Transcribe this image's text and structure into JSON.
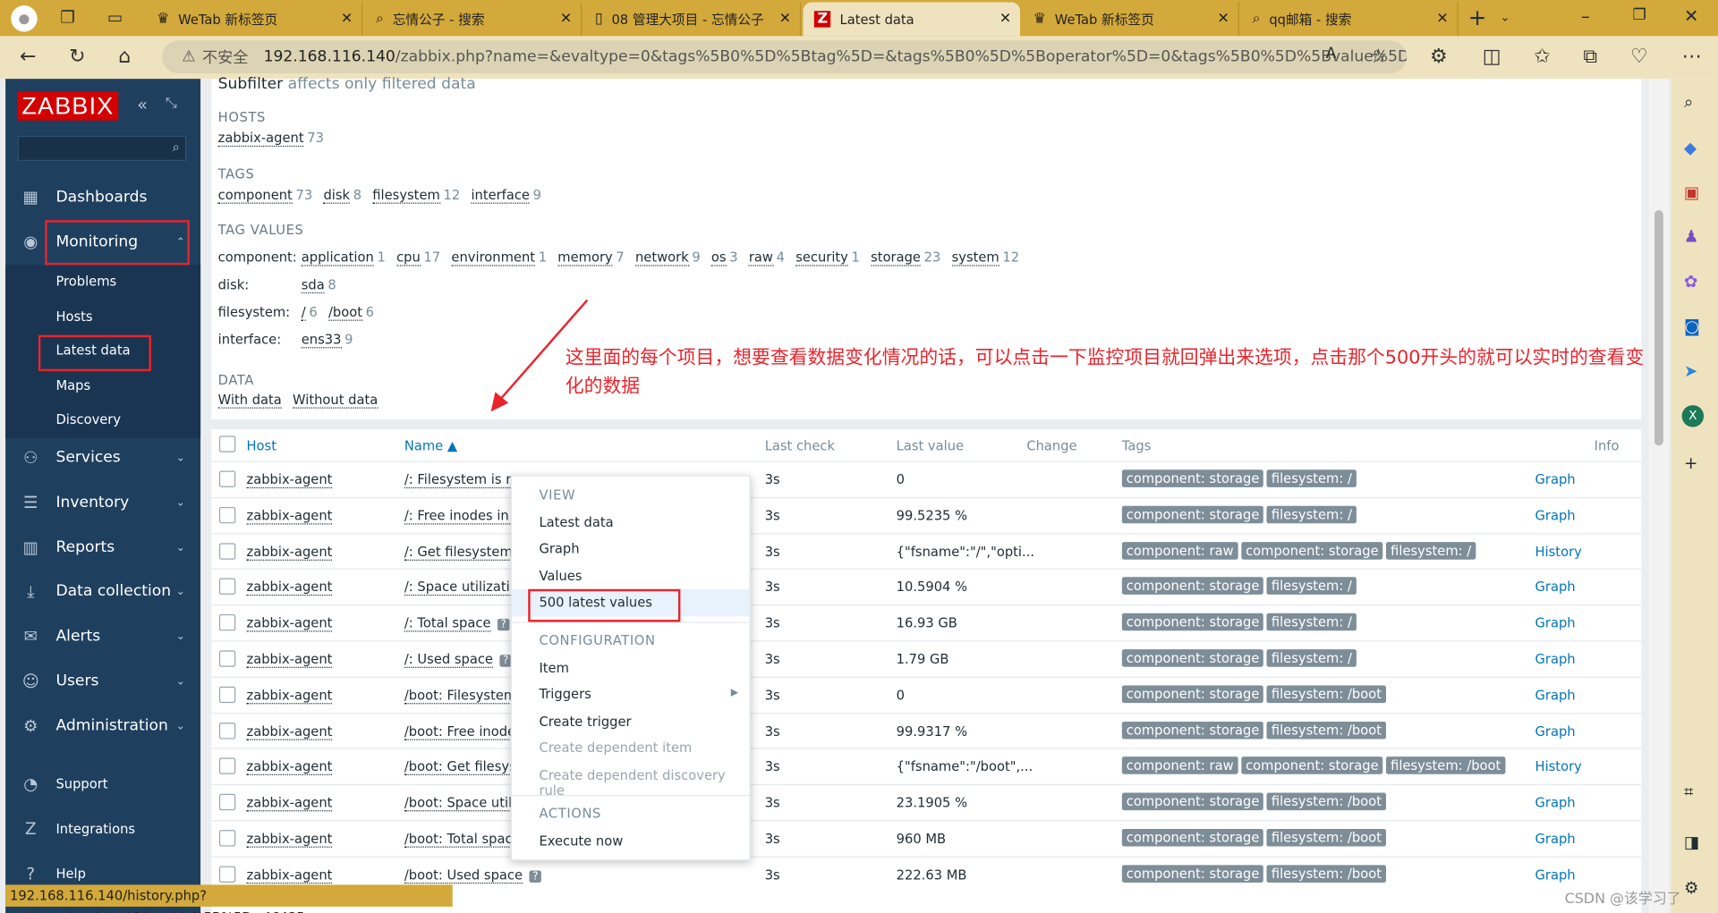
{
  "browser": {
    "tabs": [
      {
        "label": "WeTab 新标签页",
        "icon": "wetab-icon"
      },
      {
        "label": "忘情公子 - 搜索",
        "icon": "search-icon"
      },
      {
        "label": "08 管理大项目 - 忘情公子",
        "icon": "document-icon"
      },
      {
        "label": "Latest data",
        "icon": "zabbix-icon",
        "active": true
      },
      {
        "label": "WeTab 新标签页",
        "icon": "wetab-icon"
      },
      {
        "label": "qq邮箱 - 搜索",
        "icon": "search-icon"
      }
    ],
    "insecure_label": "不安全",
    "url_host": "192.168.116.140",
    "url_path": "/zabbix.php?name=&evaltype=0&tags%5B0%5D%5Btag%5D=&tags%5B0%5D%5Boperator%5D=0&tags%5B0%5D%5Bvalue%5D...",
    "status_url": "192.168.116.140/history.php?action=showlatest&itemids%5B%5D=46435",
    "watermark": "CSDN @该学习了"
  },
  "sidebar": {
    "logo": "ZABBIX",
    "items": [
      {
        "label": "Dashboards",
        "icon": "dashboard-icon"
      },
      {
        "label": "Monitoring",
        "icon": "eye-icon"
      },
      {
        "label": "Services",
        "icon": "services-icon"
      },
      {
        "label": "Inventory",
        "icon": "list-icon"
      },
      {
        "label": "Reports",
        "icon": "report-icon"
      },
      {
        "label": "Data collection",
        "icon": "download-icon"
      },
      {
        "label": "Alerts",
        "icon": "envelope-icon"
      },
      {
        "label": "Users",
        "icon": "users-icon"
      },
      {
        "label": "Administration",
        "icon": "gear-icon"
      }
    ],
    "monitoring_sub": [
      "Problems",
      "Hosts",
      "Latest data",
      "Maps",
      "Discovery"
    ],
    "bottom": [
      {
        "label": "Support"
      },
      {
        "label": "Integrations"
      },
      {
        "label": "Help"
      }
    ]
  },
  "subfilter": {
    "title": "Subfilter",
    "note": "affects only filtered data",
    "hosts_label": "HOSTS",
    "hosts": [
      {
        "name": "zabbix-agent",
        "count": "73"
      }
    ],
    "tags_label": "TAGS",
    "tags": [
      {
        "name": "component",
        "count": "73"
      },
      {
        "name": "disk",
        "count": "8"
      },
      {
        "name": "filesystem",
        "count": "12"
      },
      {
        "name": "interface",
        "count": "9"
      }
    ],
    "tag_values_label": "TAG VALUES",
    "tag_values": [
      {
        "key": "component:",
        "values": [
          {
            "name": "application",
            "count": "1"
          },
          {
            "name": "cpu",
            "count": "17"
          },
          {
            "name": "environment",
            "count": "1"
          },
          {
            "name": "memory",
            "count": "7"
          },
          {
            "name": "network",
            "count": "9"
          },
          {
            "name": "os",
            "count": "3"
          },
          {
            "name": "raw",
            "count": "4"
          },
          {
            "name": "security",
            "count": "1"
          },
          {
            "name": "storage",
            "count": "23"
          },
          {
            "name": "system",
            "count": "12"
          }
        ]
      },
      {
        "key": "disk:",
        "values": [
          {
            "name": "sda",
            "count": "8"
          }
        ]
      },
      {
        "key": "filesystem:",
        "values": [
          {
            "name": "/",
            "count": "6"
          },
          {
            "name": "/boot",
            "count": "6"
          }
        ]
      },
      {
        "key": "interface:",
        "values": [
          {
            "name": "ens33",
            "count": "9"
          }
        ]
      }
    ],
    "data_label": "DATA",
    "data": [
      "With data",
      "Without data"
    ]
  },
  "annotation": "这里面的每个项目，想要查看数据变化情况的话，可以点击一下监控项目就回弹出来选项，点击那个500开头的就可以实时的查看变化的数据",
  "table": {
    "headers": {
      "host": "Host",
      "name": "Name ▲",
      "last_check": "Last check",
      "last_value": "Last value",
      "change": "Change",
      "tags": "Tags",
      "info": "Info"
    },
    "rows": [
      {
        "host": "zabbix-agent",
        "name": "/: Filesystem is re",
        "check": "3s",
        "value": "0",
        "tags": [
          "component: storage",
          "filesystem: /"
        ],
        "info": "Graph"
      },
      {
        "host": "zabbix-agent",
        "name": "/: Free inodes in %",
        "check": "3s",
        "value": "99.5235 %",
        "tags": [
          "component: storage",
          "filesystem: /"
        ],
        "info": "Graph"
      },
      {
        "host": "zabbix-agent",
        "name": "/: Get filesystem d",
        "check": "3s",
        "value": "{\"fsname\":\"/\",\"opti...",
        "tags": [
          "component: raw",
          "component: storage",
          "filesystem: /"
        ],
        "info": "History"
      },
      {
        "host": "zabbix-agent",
        "name": "/: Space utilization",
        "check": "3s",
        "value": "10.5904 %",
        "tags": [
          "component: storage",
          "filesystem: /"
        ],
        "info": "Graph"
      },
      {
        "host": "zabbix-agent",
        "name": "/: Total space",
        "help": "?",
        "check": "3s",
        "value": "16.93 GB",
        "tags": [
          "component: storage",
          "filesystem: /"
        ],
        "info": "Graph"
      },
      {
        "host": "zabbix-agent",
        "name": "/: Used space",
        "help": "?",
        "check": "3s",
        "value": "1.79 GB",
        "tags": [
          "component: storage",
          "filesystem: /"
        ],
        "info": "Graph"
      },
      {
        "host": "zabbix-agent",
        "name": "/boot: Filesystem",
        "check": "3s",
        "value": "0",
        "tags": [
          "component: storage",
          "filesystem: /boot"
        ],
        "info": "Graph"
      },
      {
        "host": "zabbix-agent",
        "name": "/boot: Free inodes",
        "check": "3s",
        "value": "99.9317 %",
        "tags": [
          "component: storage",
          "filesystem: /boot"
        ],
        "info": "Graph"
      },
      {
        "host": "zabbix-agent",
        "name": "/boot: Get filesyste",
        "check": "3s",
        "value": "{\"fsname\":\"/boot\",...",
        "tags": [
          "component: raw",
          "component: storage",
          "filesystem: /boot"
        ],
        "info": "History"
      },
      {
        "host": "zabbix-agent",
        "name": "/boot: Space utiliz",
        "check": "3s",
        "value": "23.1905 %",
        "tags": [
          "component: storage",
          "filesystem: /boot"
        ],
        "info": "Graph"
      },
      {
        "host": "zabbix-agent",
        "name": "/boot: Total space",
        "check": "3s",
        "value": "960 MB",
        "tags": [
          "component: storage",
          "filesystem: /boot"
        ],
        "info": "Graph"
      },
      {
        "host": "zabbix-agent",
        "name": "/boot: Used space",
        "help": "?",
        "check": "3s",
        "value": "222.63 MB",
        "tags": [
          "component: storage",
          "filesystem: /boot"
        ],
        "info": "Graph"
      }
    ]
  },
  "context_menu": {
    "view_label": "VIEW",
    "view": [
      "Latest data",
      "Graph",
      "Values",
      "500 latest values"
    ],
    "config_label": "CONFIGURATION",
    "config": [
      "Item",
      "Triggers",
      "Create trigger",
      "Create dependent item",
      "Create dependent discovery rule"
    ],
    "actions_label": "ACTIONS",
    "actions": [
      "Execute now"
    ]
  },
  "colors": {
    "accent_red": "#e8242c",
    "sidebar": "#1f3f5e",
    "link": "#0275b8",
    "tag": "#7e8e99"
  }
}
